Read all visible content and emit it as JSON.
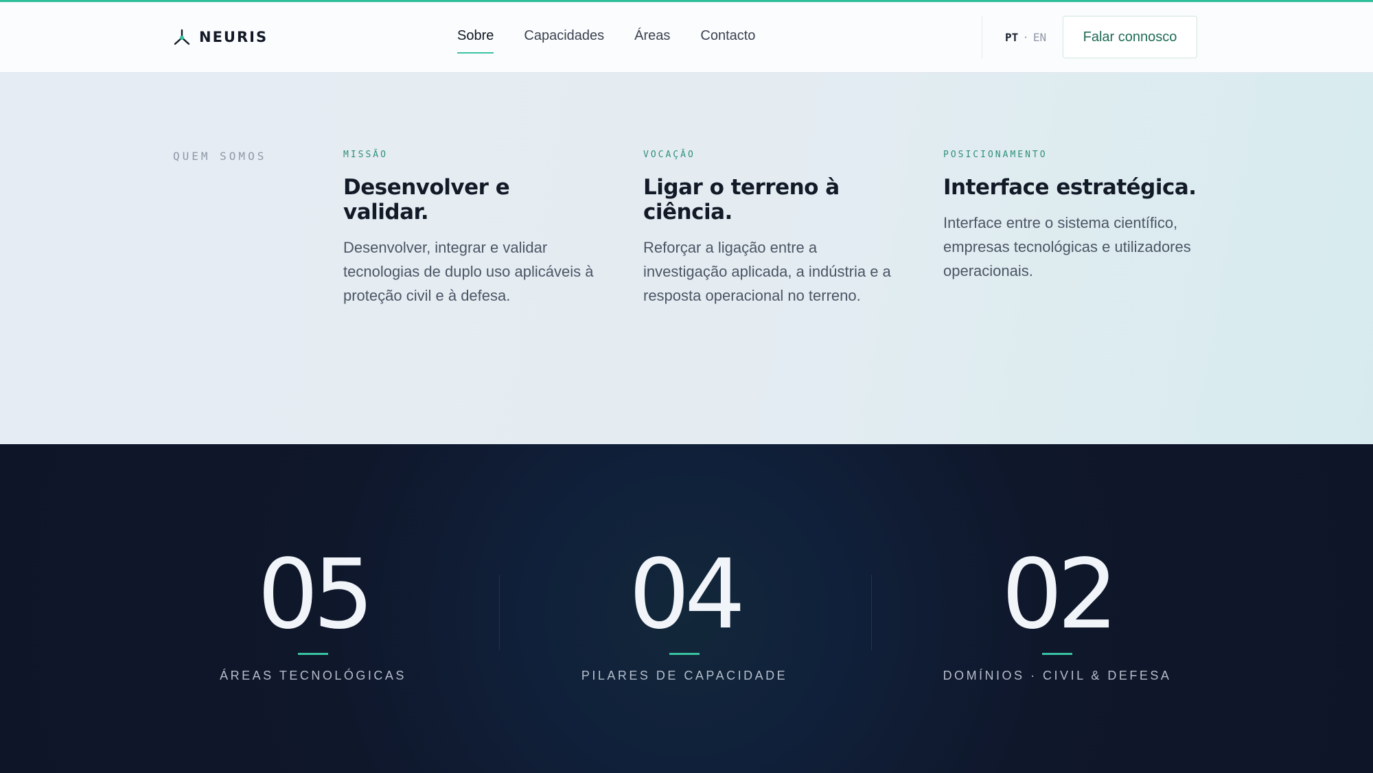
{
  "brand": {
    "name": "NEURIS",
    "accent": "#2fbf9b"
  },
  "nav": {
    "items": [
      {
        "label": "Sobre",
        "active": true
      },
      {
        "label": "Capacidades",
        "active": false
      },
      {
        "label": "Áreas",
        "active": false
      },
      {
        "label": "Contacto",
        "active": false
      }
    ]
  },
  "lang": {
    "pt": "PT",
    "separator": "·",
    "en": "EN",
    "selected": "PT"
  },
  "cta": {
    "label": "Falar connosco"
  },
  "about": {
    "section_label": "QUEM SOMOS",
    "columns": [
      {
        "eyebrow": "MISSÃO",
        "title": "Desenvolver e validar.",
        "text": "Desenvolver, integrar e validar tecnologias de duplo uso aplicáveis à proteção civil e à defesa."
      },
      {
        "eyebrow": "VOCAÇÃO",
        "title": "Ligar o terreno à ciência.",
        "text": "Reforçar a ligação entre a investigação aplicada, a indústria e a resposta operacional no terreno."
      },
      {
        "eyebrow": "POSICIONAMENTO",
        "title": "Interface estratégica.",
        "text": "Interface entre o sistema científico, empresas tecnológicas e utilizadores operacionais."
      }
    ]
  },
  "stats": [
    {
      "value": "05",
      "label": "ÁREAS TECNOLÓGICAS"
    },
    {
      "value": "04",
      "label": "PILARES DE CAPACIDADE"
    },
    {
      "value": "02",
      "label": "DOMÍNIOS · CIVIL & DEFESA"
    }
  ]
}
